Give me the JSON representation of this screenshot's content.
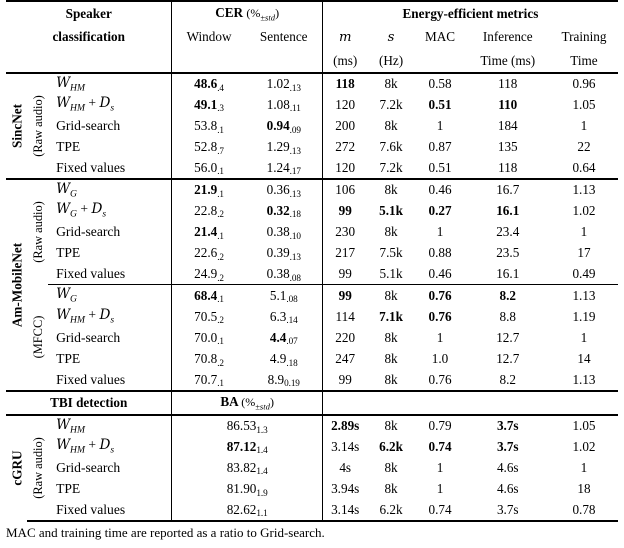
{
  "header": {
    "group1_line1": "Speaker",
    "group1_line2": "classification",
    "cer_label": "CER",
    "cer_units": "(%±std)",
    "cer_sub1": "Window",
    "cer_sub2": "Sentence",
    "energy_label": "Energy-efficient metrics",
    "m_label": "m",
    "m_unit": "(ms)",
    "s_label": "s",
    "s_unit": "(Hz)",
    "mac_label": "MAC",
    "inference_l1": "Inference",
    "inference_l2": "Time (ms)",
    "training_l1": "Training",
    "training_l2": "Time"
  },
  "tbi_header": {
    "label": "TBI detection",
    "ba_label": "BA",
    "ba_units": "(%±std)"
  },
  "groups": [
    {
      "name": "SincNet",
      "subname": "(Raw audio)",
      "rows": [
        {
          "method": "W_HM",
          "method_base": "W",
          "method_sub": "HM",
          "method_extra": "",
          "cer_window": "48.6",
          "cer_window_sub": ".4",
          "cer_window_bold": true,
          "cer_sentence": "1.02",
          "cer_sentence_sub": ".13",
          "cer_sentence_bold": false,
          "m": "118",
          "m_bold": true,
          "s": "8k",
          "s_bold": false,
          "mac": "0.58",
          "mac_bold": false,
          "inference": "118",
          "inference_bold": false,
          "training": "0.96",
          "training_bold": false
        },
        {
          "method_base": "W",
          "method_sub": "HM",
          "method_extra": " + D_s",
          "cer_window": "49.1",
          "cer_window_sub": ".3",
          "cer_window_bold": true,
          "cer_sentence": "1.08",
          "cer_sentence_sub": ".11",
          "cer_sentence_bold": false,
          "m": "120",
          "m_bold": false,
          "s": "7.2k",
          "s_bold": false,
          "mac": "0.51",
          "mac_bold": true,
          "inference": "110",
          "inference_bold": true,
          "training": "1.05",
          "training_bold": false
        },
        {
          "method_plain": "Grid-search",
          "cer_window": "53.8",
          "cer_window_sub": ".1",
          "cer_window_bold": false,
          "cer_sentence": "0.94",
          "cer_sentence_sub": ".09",
          "cer_sentence_bold": true,
          "m": "200",
          "m_bold": false,
          "s": "8k",
          "s_bold": false,
          "mac": "1",
          "mac_bold": false,
          "inference": "184",
          "inference_bold": false,
          "training": "1",
          "training_bold": false
        },
        {
          "method_plain": "TPE",
          "cer_window": "52.8",
          "cer_window_sub": ".7",
          "cer_window_bold": false,
          "cer_sentence": "1.29",
          "cer_sentence_sub": ".13",
          "cer_sentence_bold": false,
          "m": "272",
          "m_bold": false,
          "s": "7.6k",
          "s_bold": false,
          "mac": "0.87",
          "mac_bold": false,
          "inference": "135",
          "inference_bold": false,
          "training": "22",
          "training_bold": false
        },
        {
          "method_plain": "Fixed values",
          "cer_window": "56.0",
          "cer_window_sub": ".1",
          "cer_window_bold": false,
          "cer_sentence": "1.24",
          "cer_sentence_sub": ".17",
          "cer_sentence_bold": false,
          "m": "120",
          "m_bold": false,
          "s": "7.2k",
          "s_bold": false,
          "mac": "0.51",
          "mac_bold": false,
          "inference": "118",
          "inference_bold": false,
          "training": "0.64",
          "training_bold": false
        }
      ]
    },
    {
      "name": "Am-MobileNet",
      "subname": "(Raw audio)",
      "rows": [
        {
          "method_base": "W",
          "method_sub": "G",
          "method_extra": "",
          "cer_window": "21.9",
          "cer_window_sub": ".1",
          "cer_window_bold": true,
          "cer_sentence": "0.36",
          "cer_sentence_sub": ".13",
          "cer_sentence_bold": false,
          "m": "106",
          "m_bold": false,
          "s": "8k",
          "s_bold": false,
          "mac": "0.46",
          "mac_bold": false,
          "inference": "16.7",
          "inference_bold": false,
          "training": "1.13",
          "training_bold": false
        },
        {
          "method_base": "W",
          "method_sub": "G",
          "method_extra": " + D_s",
          "cer_window": "22.8",
          "cer_window_sub": ".2",
          "cer_window_bold": false,
          "cer_sentence": "0.32",
          "cer_sentence_sub": ".18",
          "cer_sentence_bold": true,
          "m": "99",
          "m_bold": true,
          "s": "5.1k",
          "s_bold": true,
          "mac": "0.27",
          "mac_bold": true,
          "inference": "16.1",
          "inference_bold": true,
          "training": "1.02",
          "training_bold": false
        },
        {
          "method_plain": "Grid-search",
          "cer_window": "21.4",
          "cer_window_sub": ".1",
          "cer_window_bold": true,
          "cer_sentence": "0.38",
          "cer_sentence_sub": ".10",
          "cer_sentence_bold": false,
          "m": "230",
          "m_bold": false,
          "s": "8k",
          "s_bold": false,
          "mac": "1",
          "mac_bold": false,
          "inference": "23.4",
          "inference_bold": false,
          "training": "1",
          "training_bold": false
        },
        {
          "method_plain": "TPE",
          "cer_window": "22.6",
          "cer_window_sub": ".2",
          "cer_window_bold": false,
          "cer_sentence": "0.39",
          "cer_sentence_sub": ".13",
          "cer_sentence_bold": false,
          "m": "217",
          "m_bold": false,
          "s": "7.5k",
          "s_bold": false,
          "mac": "0.88",
          "mac_bold": false,
          "inference": "23.5",
          "inference_bold": false,
          "training": "17",
          "training_bold": false
        },
        {
          "method_plain": "Fixed values",
          "cer_window": "24.9",
          "cer_window_sub": ".2",
          "cer_window_bold": false,
          "cer_sentence": "0.38",
          "cer_sentence_sub": ".08",
          "cer_sentence_bold": false,
          "m": "99",
          "m_bold": false,
          "s": "5.1k",
          "s_bold": false,
          "mac": "0.46",
          "mac_bold": false,
          "inference": "16.1",
          "inference_bold": false,
          "training": "0.49",
          "training_bold": false
        }
      ]
    },
    {
      "name": "",
      "subname": "(MFCC)",
      "rows": [
        {
          "method_base": "W",
          "method_sub": "G",
          "method_extra": "",
          "cer_window": "68.4",
          "cer_window_sub": ".1",
          "cer_window_bold": true,
          "cer_sentence": "5.1",
          "cer_sentence_sub": ".08",
          "cer_sentence_bold": false,
          "m": "99",
          "m_bold": true,
          "s": "8k",
          "s_bold": false,
          "mac": "0.76",
          "mac_bold": true,
          "inference": "8.2",
          "inference_bold": true,
          "training": "1.13",
          "training_bold": false
        },
        {
          "method_base": "W",
          "method_sub": "HM",
          "method_extra": " + D_s",
          "cer_window": "70.5",
          "cer_window_sub": ".2",
          "cer_window_bold": false,
          "cer_sentence": "6.3",
          "cer_sentence_sub": ".14",
          "cer_sentence_bold": false,
          "m": "114",
          "m_bold": false,
          "s": "7.1k",
          "s_bold": true,
          "mac": "0.76",
          "mac_bold": true,
          "inference": "8.8",
          "inference_bold": false,
          "training": "1.19",
          "training_bold": false
        },
        {
          "method_plain": "Grid-search",
          "cer_window": "70.0",
          "cer_window_sub": ".1",
          "cer_window_bold": false,
          "cer_sentence": "4.4",
          "cer_sentence_sub": ".07",
          "cer_sentence_bold": true,
          "m": "220",
          "m_bold": false,
          "s": "8k",
          "s_bold": false,
          "mac": "1",
          "mac_bold": false,
          "inference": "12.7",
          "inference_bold": false,
          "training": "1",
          "training_bold": false
        },
        {
          "method_plain": "TPE",
          "cer_window": "70.8",
          "cer_window_sub": ".2",
          "cer_window_bold": false,
          "cer_sentence": "4.9",
          "cer_sentence_sub": ".18",
          "cer_sentence_bold": false,
          "m": "247",
          "m_bold": false,
          "s": "8k",
          "s_bold": false,
          "mac": "1.0",
          "mac_bold": false,
          "inference": "12.7",
          "inference_bold": false,
          "training": "14",
          "training_bold": false
        },
        {
          "method_plain": "Fixed values",
          "cer_window": "70.7",
          "cer_window_sub": ".1",
          "cer_window_bold": false,
          "cer_sentence": "8.9",
          "cer_sentence_sub": "0.19",
          "cer_sentence_bold": false,
          "m": "99",
          "m_bold": false,
          "s": "8k",
          "s_bold": false,
          "mac": "0.76",
          "mac_bold": false,
          "inference": "8.2",
          "inference_bold": false,
          "training": "1.13",
          "training_bold": false
        }
      ]
    }
  ],
  "tbi_group": {
    "name": "cGRU",
    "subname": "(Raw audio)",
    "rows": [
      {
        "method_base": "W",
        "method_sub": "HM",
        "method_extra": "",
        "ba": "86.53",
        "ba_sub": "1.3",
        "ba_bold": false,
        "m": "2.89s",
        "m_bold": true,
        "s": "8k",
        "s_bold": false,
        "mac": "0.79",
        "mac_bold": false,
        "inference": "3.7s",
        "inference_bold": true,
        "training": "1.05",
        "training_bold": false
      },
      {
        "method_base": "W",
        "method_sub": "HM",
        "method_extra": " + D_s",
        "ba": "87.12",
        "ba_sub": "1.4",
        "ba_bold": true,
        "m": "3.14s",
        "m_bold": false,
        "s": "6.2k",
        "s_bold": true,
        "mac": "0.74",
        "mac_bold": true,
        "inference": "3.7s",
        "inference_bold": true,
        "training": "1.02",
        "training_bold": false
      },
      {
        "method_plain": "Grid-search",
        "ba": "83.82",
        "ba_sub": "1.4",
        "ba_bold": false,
        "m": "4s",
        "m_bold": false,
        "s": "8k",
        "s_bold": false,
        "mac": "1",
        "mac_bold": false,
        "inference": "4.6s",
        "inference_bold": false,
        "training": "1",
        "training_bold": false
      },
      {
        "method_plain": "TPE",
        "ba": "81.90",
        "ba_sub": "1.9",
        "ba_bold": false,
        "m": "3.94s",
        "m_bold": false,
        "s": "8k",
        "s_bold": false,
        "mac": "1",
        "mac_bold": false,
        "inference": "4.6s",
        "inference_bold": false,
        "training": "18",
        "training_bold": false
      },
      {
        "method_plain": "Fixed values",
        "ba": "82.62",
        "ba_sub": "1.1",
        "ba_bold": false,
        "m": "3.14s",
        "m_bold": false,
        "s": "6.2k",
        "s_bold": false,
        "mac": "0.74",
        "mac_bold": false,
        "inference": "3.7s",
        "inference_bold": false,
        "training": "0.78",
        "training_bold": false
      }
    ]
  },
  "footnote": "MAC and training time are reported as a ratio to Grid-search."
}
